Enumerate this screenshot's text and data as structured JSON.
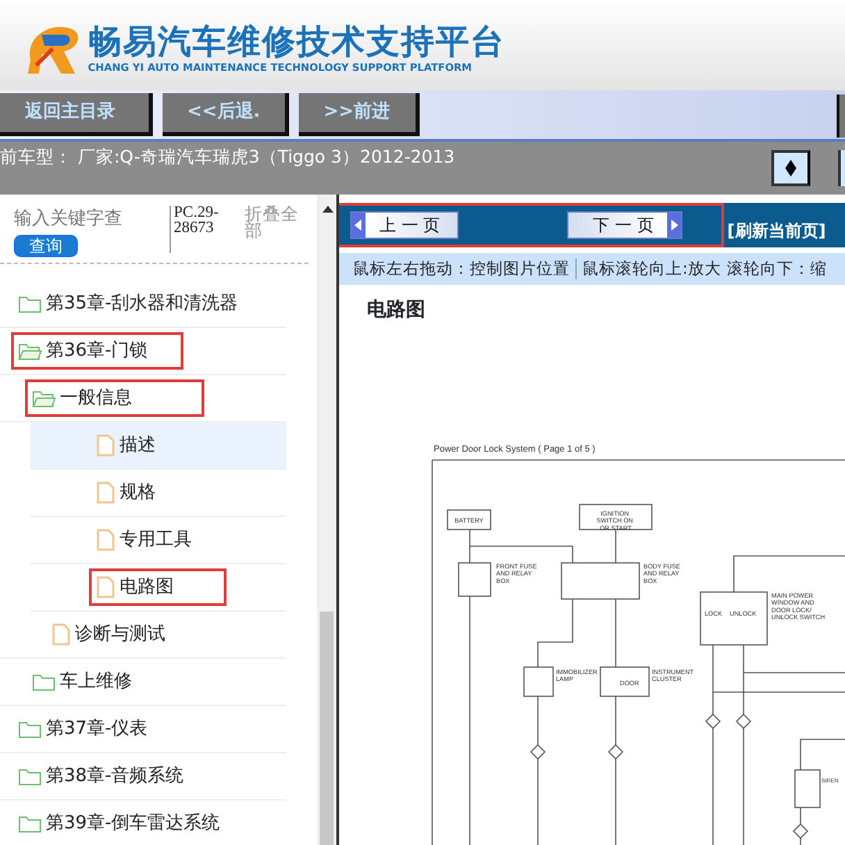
{
  "header": {
    "title": "畅易汽车维修技术支持平台",
    "subtitle": "CHANG YI AUTO MAINTENANCE TECHNOLOGY SUPPORT PLATFORM"
  },
  "toolbar": {
    "buttons": [
      "返回主目录",
      "<<后退.",
      ">>前进"
    ]
  },
  "vehicle_bar": {
    "text": "前车型：  厂家:Q-奇瑞汽车瑞虎3（Tiggo 3）2012-2013"
  },
  "sidebar": {
    "search": {
      "placeholder": "输入关键字查",
      "button": "查询"
    },
    "code": "PC.29-28673",
    "collapse_all": "折叠全部",
    "tree": [
      {
        "label": "第35章-刮水器和清洗器",
        "kind": "folder",
        "expanded": false,
        "selected": false,
        "highlighted": false
      },
      {
        "label": "第36章-门锁",
        "kind": "folder",
        "expanded": true,
        "selected": false,
        "highlighted": true,
        "children": [
          {
            "label": "一般信息",
            "kind": "folder",
            "expanded": true,
            "selected": false,
            "highlighted": true,
            "children": [
              {
                "label": "描述",
                "kind": "file",
                "selected": true,
                "highlighted": false
              },
              {
                "label": "规格",
                "kind": "file",
                "selected": false,
                "highlighted": false
              },
              {
                "label": "专用工具",
                "kind": "file",
                "selected": false,
                "highlighted": false
              },
              {
                "label": "电路图",
                "kind": "file",
                "selected": false,
                "highlighted": true
              }
            ]
          },
          {
            "label": "诊断与测试",
            "kind": "file",
            "selected": false,
            "highlighted": false
          },
          {
            "label": "车上维修",
            "kind": "folder",
            "expanded": false,
            "selected": false,
            "highlighted": false
          }
        ]
      },
      {
        "label": "第37章-仪表",
        "kind": "folder",
        "expanded": false,
        "selected": false,
        "highlighted": false
      },
      {
        "label": "第38章-音频系统",
        "kind": "folder",
        "expanded": false,
        "selected": false,
        "highlighted": false
      },
      {
        "label": "第39章-倒车雷达系统",
        "kind": "folder",
        "expanded": false,
        "selected": false,
        "highlighted": false
      }
    ]
  },
  "viewer": {
    "pager": {
      "prev": "上 一 页",
      "next": "下 一 页",
      "refresh": "[刷新当前页]",
      "highlighted": true
    },
    "hints": [
      "鼠标左右拖动：控制图片位置",
      "鼠标滚轮向上:放大",
      "滚轮向下：缩"
    ],
    "page_title": "电路图",
    "diagram": {
      "title": "Power Door Lock System ( Page 1 of 5 )",
      "labels": [
        "BATTERY",
        "IGNITION SWITCH ON OR START",
        "FRONT FUSE AND RELAY BOX",
        "BODY FUSE AND RELAY BOX",
        "LOCK",
        "UNLOCK",
        "MAIN POWER WINDOW AND DOOR LOCK/ UNLOCK SWITCH",
        "IMMOBILIZER LAMP",
        "DOOR",
        "INSTRUMENT CLUSTER",
        "SIREN"
      ]
    }
  }
}
